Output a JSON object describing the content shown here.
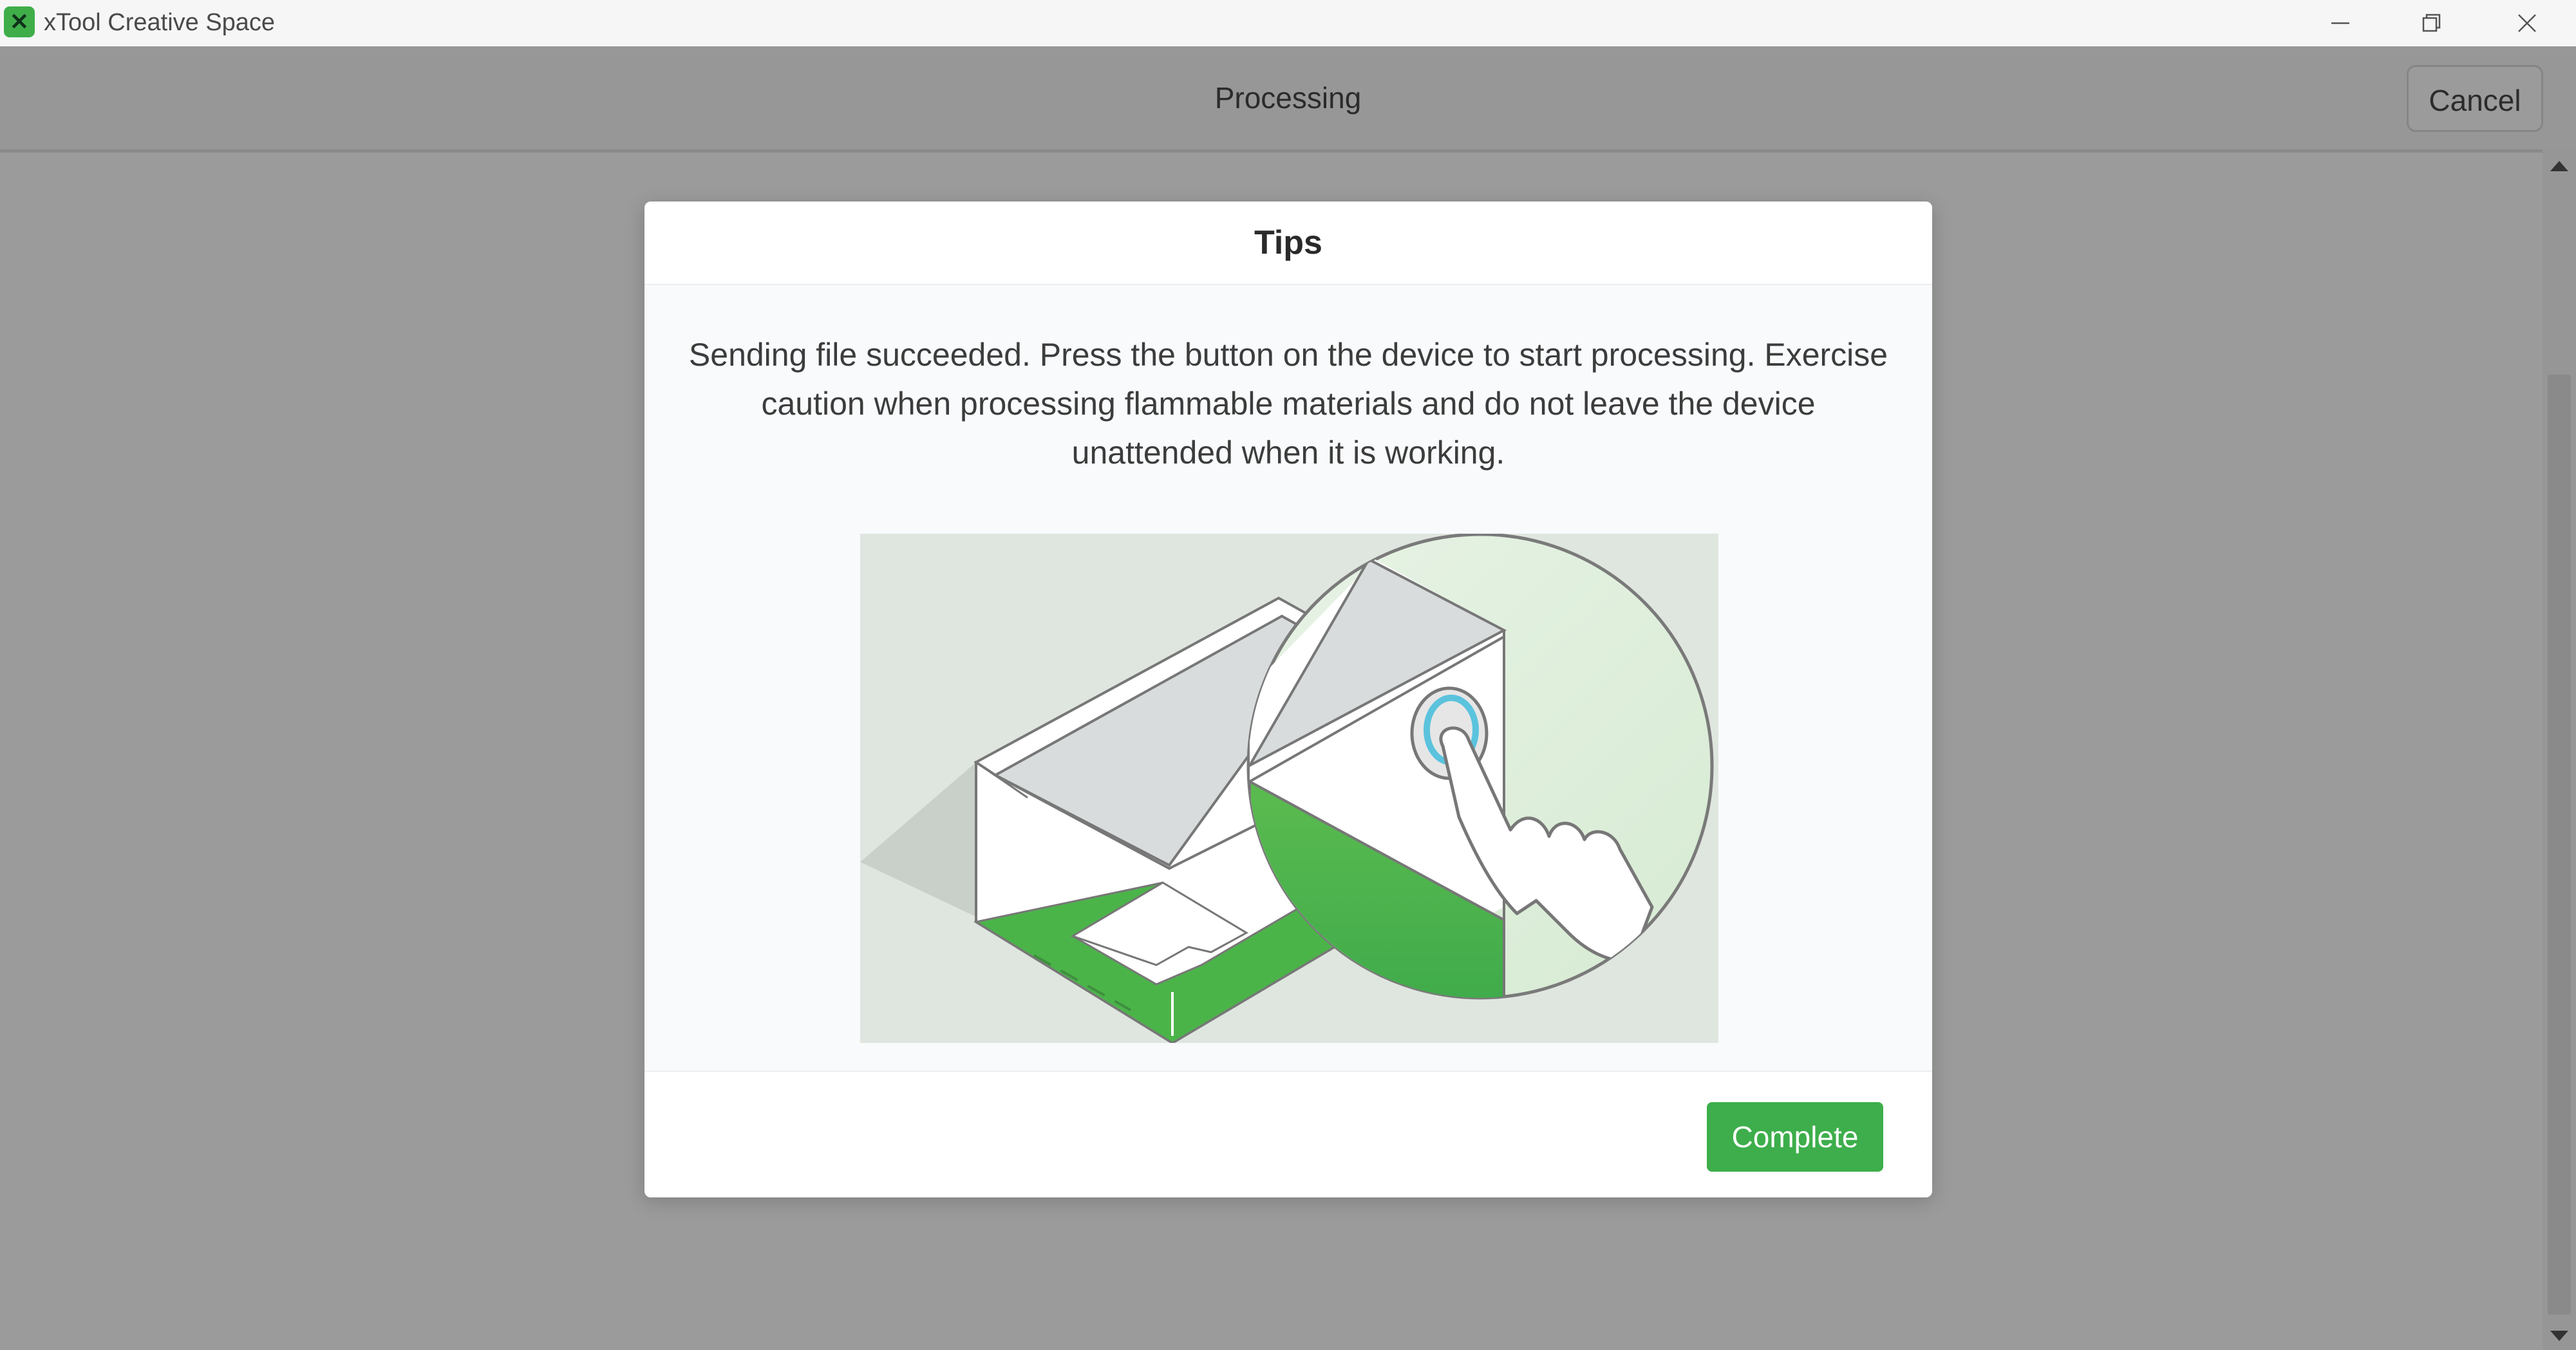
{
  "window": {
    "title": "xTool Creative Space",
    "logo_glyph": "✕",
    "controls": [
      "minimize-icon",
      "restore-icon",
      "close-icon"
    ]
  },
  "header": {
    "title": "Processing",
    "cancel_label": "Cancel"
  },
  "dialog": {
    "title": "Tips",
    "message": "Sending file succeeded. Press the button on the device to start processing. Exercise caution when processing flammable materials and do not leave the device unattended when it is working.",
    "illustration_icon": "press-device-button-illustration",
    "complete_label": "Complete"
  },
  "colors": {
    "accent_green": "#3dae4b",
    "button_highlight": "#5bc3dd",
    "overlay": "#9a9b9a"
  }
}
